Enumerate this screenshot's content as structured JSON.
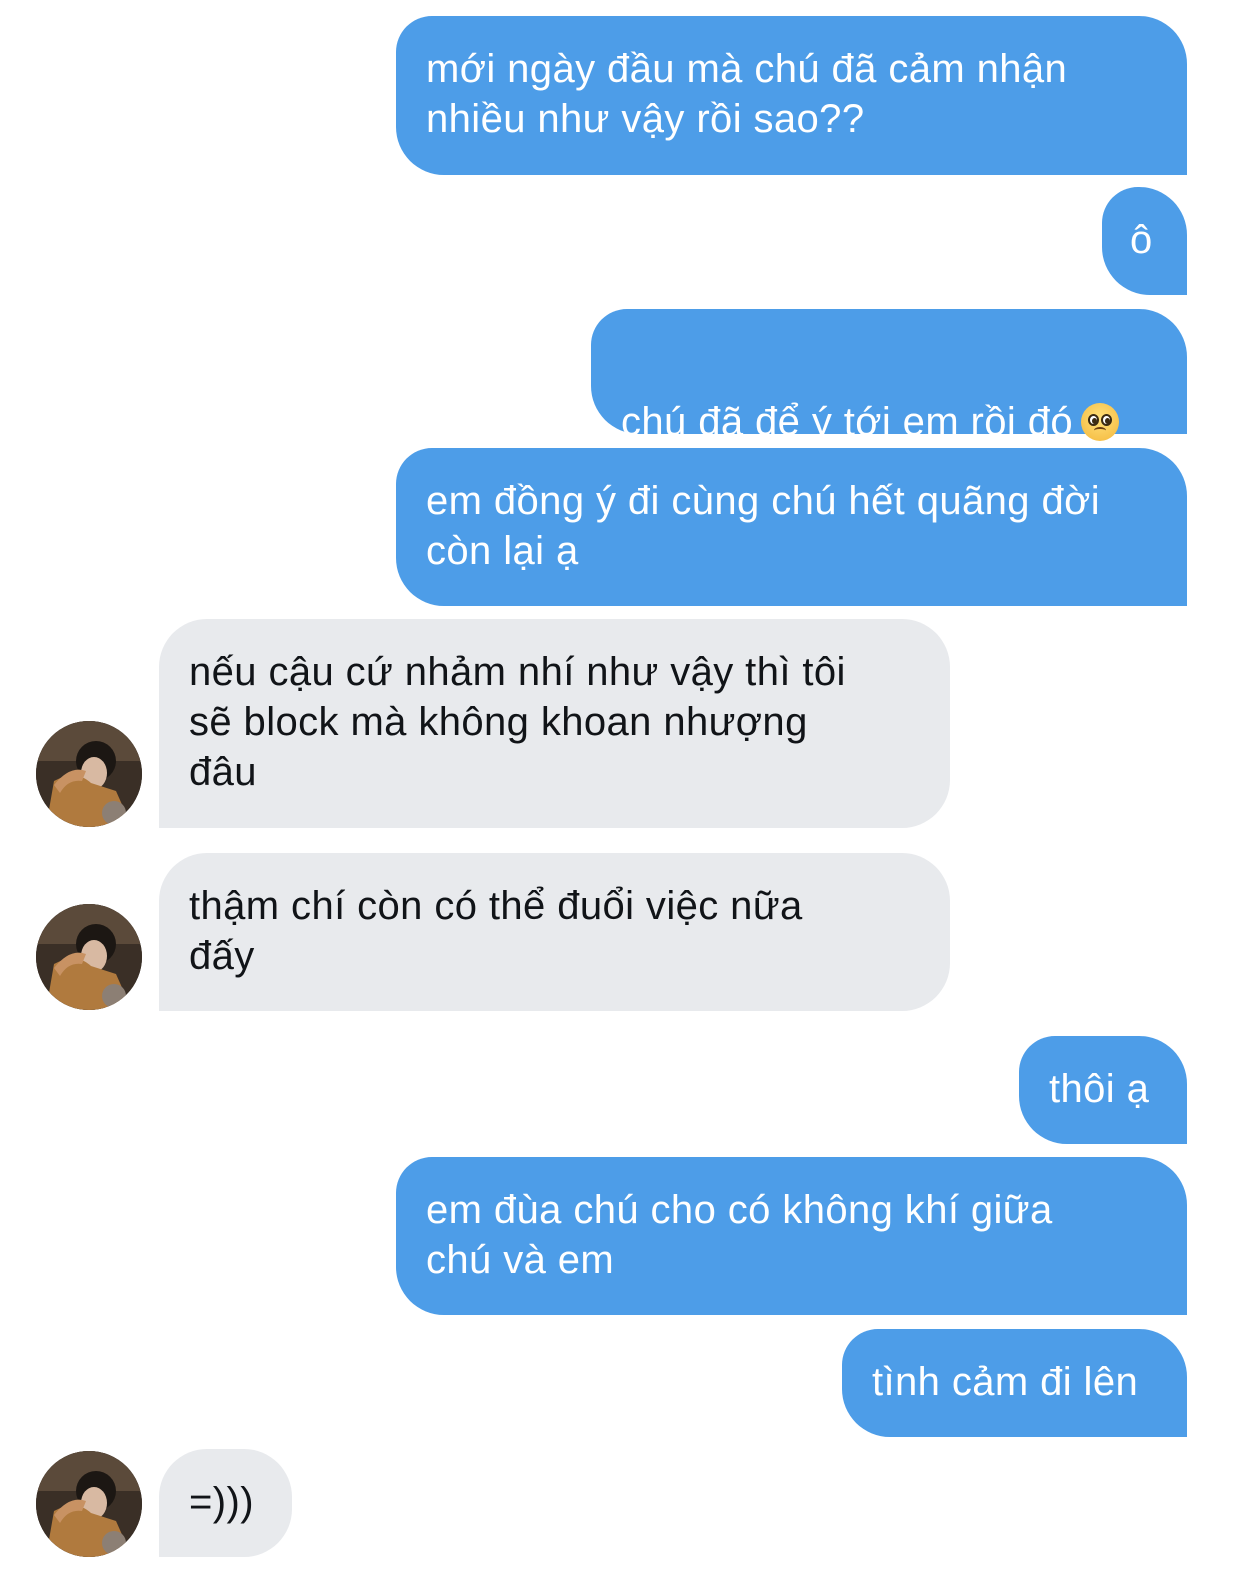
{
  "conversation": {
    "messages": [
      {
        "sender": "me",
        "text": "mới ngày đầu mà chú đã cảm nhận\nnhiều như vậy rồi sao??"
      },
      {
        "sender": "me",
        "text": "ô"
      },
      {
        "sender": "me",
        "text": "chú đã để ý tới em rồi đó",
        "emoji": "pleading-face-emoji"
      },
      {
        "sender": "me",
        "text": "em đồng ý đi cùng chú hết quãng đời\ncòn lại ạ"
      },
      {
        "sender": "other",
        "text": "nếu cậu cứ nhảm nhí như vậy thì tôi\nsẽ block mà không khoan nhượng\nđâu"
      },
      {
        "sender": "other",
        "text": "thậm chí còn có thể đuổi việc nữa\nđấy"
      },
      {
        "sender": "me",
        "text": "thôi ạ"
      },
      {
        "sender": "me",
        "text": "em đùa chú cho có không khí giữa\nchú và em"
      },
      {
        "sender": "me",
        "text": "tình cảm đi lên"
      },
      {
        "sender": "other",
        "text": "=)))"
      }
    ]
  },
  "colors": {
    "outgoing_bubble": "#4d9de8",
    "incoming_bubble": "#e8eaed",
    "outgoing_text": "#ffffff",
    "incoming_text": "#111418"
  }
}
